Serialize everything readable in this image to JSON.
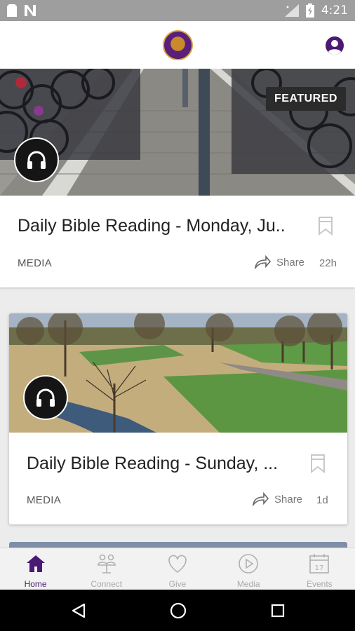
{
  "status_bar": {
    "time": "4:21"
  },
  "header": {
    "logo_name": "church-logo",
    "profile_icon": "account-icon"
  },
  "feed": [
    {
      "badge": "FEATURED",
      "title": "Daily Bible Reading - Monday, Ju..",
      "category": "MEDIA",
      "share_label": "Share",
      "age": "22h",
      "media_icon": "headphones-icon"
    },
    {
      "title": "Daily Bible Reading - Sunday, ...",
      "category": "MEDIA",
      "share_label": "Share",
      "age": "1d",
      "media_icon": "headphones-icon"
    }
  ],
  "bottom_nav": {
    "items": [
      {
        "label": "Home",
        "icon": "home-icon",
        "active": true
      },
      {
        "label": "Connect",
        "icon": "connect-icon",
        "active": false
      },
      {
        "label": "Give",
        "icon": "heart-icon",
        "active": false
      },
      {
        "label": "Media",
        "icon": "play-icon",
        "active": false
      },
      {
        "label": "Events",
        "icon": "calendar-icon",
        "active": false
      }
    ],
    "calendar_day": "17"
  },
  "colors": {
    "accent": "#4b1a75",
    "inactive": "#aaaaaa",
    "status_bar": "#9e9e9e"
  }
}
